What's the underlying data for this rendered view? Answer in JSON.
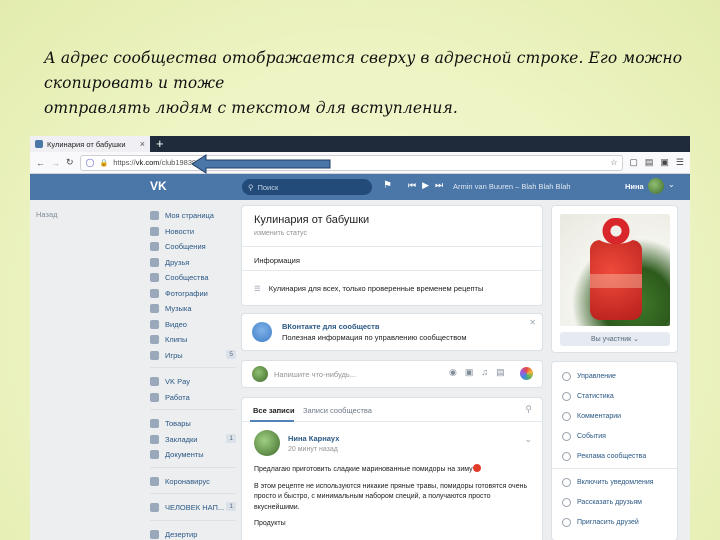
{
  "caption": {
    "line1": "А адрес сообщества отображается сверху в адресной строке. Его можно скопировать и тоже",
    "line2": "отправлять людям с текстом для вступления."
  },
  "browser": {
    "tab_title": "Кулинария от бабушки",
    "tab_close": "×",
    "new_tab": "+",
    "url_prefix": "https://",
    "url_domain": "vk.com",
    "url_path": "/club198394369"
  },
  "vk_header": {
    "logo": "VK",
    "search_placeholder": "Поиск",
    "track": "Armin van Buuren – Blah Blah Blah",
    "user_name": "Нина"
  },
  "sidebar": {
    "back_label": "Назад",
    "items": [
      {
        "label": "Моя страница"
      },
      {
        "label": "Новости"
      },
      {
        "label": "Сообщения"
      },
      {
        "label": "Друзья"
      },
      {
        "label": "Сообщества"
      },
      {
        "label": "Фотографии"
      },
      {
        "label": "Музыка"
      },
      {
        "label": "Видео"
      },
      {
        "label": "Клипы"
      },
      {
        "label": "Игры",
        "count": "5"
      }
    ],
    "items2": [
      {
        "label": "VK Pay"
      },
      {
        "label": "Работа"
      }
    ],
    "items3": [
      {
        "label": "Товары"
      },
      {
        "label": "Закладки",
        "count": "1"
      },
      {
        "label": "Документы"
      }
    ],
    "items4": [
      {
        "label": "Коронавирус"
      }
    ],
    "items5": [
      {
        "label": "ЧЕЛОВЕК НАП...",
        "count": "1"
      }
    ],
    "items6": [
      {
        "label": "Дезертир"
      }
    ]
  },
  "group": {
    "title": "Кулинария от бабушки",
    "status_hint": "изменить статус",
    "info_heading": "Информация",
    "description": "Кулинария для всех, только проверенные временем рецепты"
  },
  "promo": {
    "title": "ВКонтакте для сообществ",
    "subtitle": "Полезная информация по управлению сообществом"
  },
  "composer": {
    "placeholder": "Напишите что-нибудь..."
  },
  "feed": {
    "tab_all": "Все записи",
    "tab_community": "Записи сообщества",
    "post": {
      "author": "Нина Карнаух",
      "time": "20 минут назад",
      "p1": "Предлагаю приготовить сладкие маринованные помидоры на зиму",
      "p2": "В этом рецепте не используются никакие пряные травы, помидоры готовятся очень просто и быстро, с минимальным набором специй, а получаются просто вкуснейшими.",
      "p3": "Продукты"
    }
  },
  "right": {
    "member_button": "Вы участник ⌄",
    "menu": [
      {
        "label": "Управление"
      },
      {
        "label": "Статистика"
      },
      {
        "label": "Комментарии"
      },
      {
        "label": "События"
      },
      {
        "label": "Реклама сообщества"
      }
    ],
    "menu2": [
      {
        "label": "Включить уведомления"
      },
      {
        "label": "Рассказать друзьям"
      },
      {
        "label": "Пригласить друзей"
      }
    ]
  },
  "colors": {
    "vk_blue": "#4a76a8",
    "link": "#2a5885",
    "arrow": "#4a76a8"
  }
}
